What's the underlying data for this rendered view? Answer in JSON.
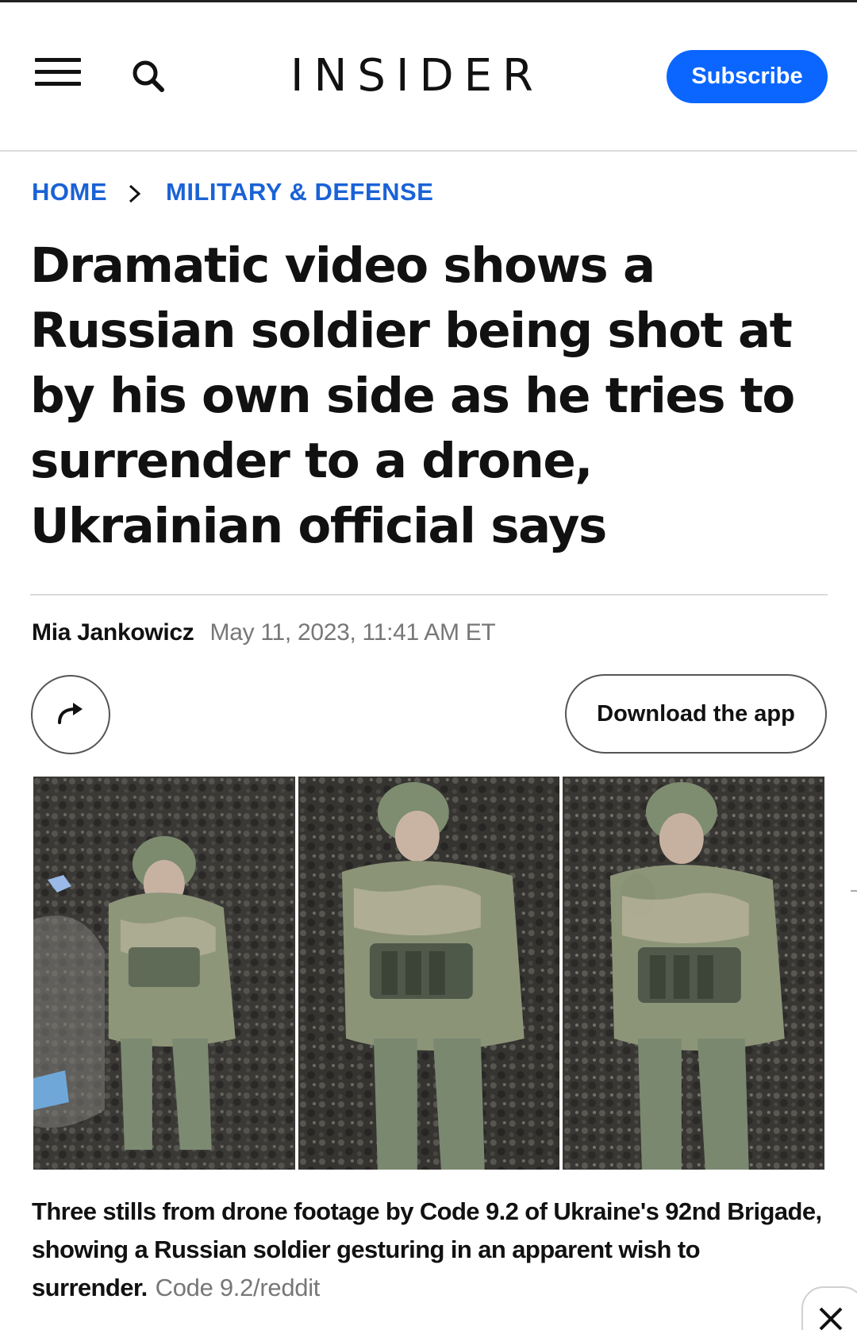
{
  "header": {
    "logo": "INSIDER",
    "subscribe_label": "Subscribe",
    "icons": {
      "menu": "hamburger-menu-icon",
      "search": "search-icon"
    }
  },
  "breadcrumb": {
    "home": "HOME",
    "section": "MILITARY & DEFENSE"
  },
  "article": {
    "title": "Dramatic video shows a Russian soldier being shot at by his own side as he tries to surrender to a drone, Ukrainian official says",
    "author": "Mia Jankowicz",
    "date": "May 11, 2023, 11:41 AM ET",
    "share_icon": "share-arrow-icon",
    "download_label": "Download the app",
    "caption": "Three stills from drone footage by Code 9.2 of Ukraine's 92nd Brigade, showing a Russian soldier gesturing in an apparent wish to surrender.",
    "credit": "Code 9.2/reddit"
  },
  "colors": {
    "accent": "#0a66ff",
    "breadcrumb": "#1a62d6",
    "muted_text": "#777777"
  }
}
